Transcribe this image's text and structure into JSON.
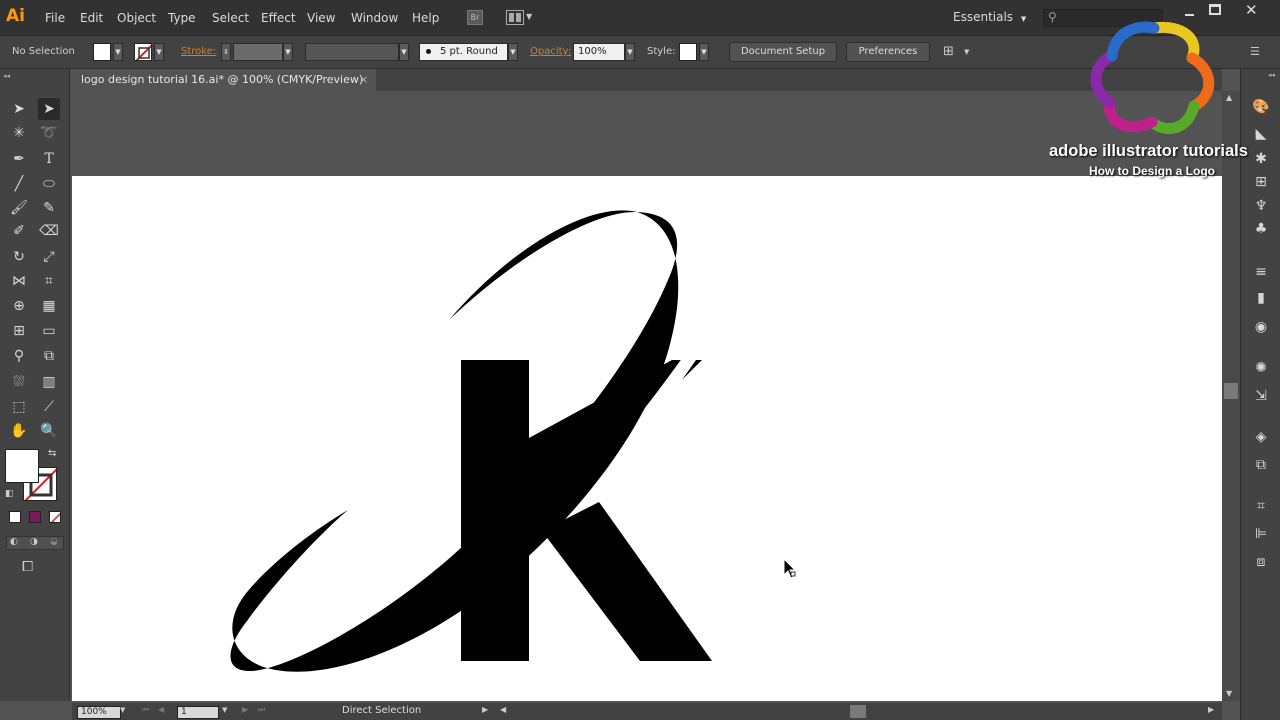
{
  "app": {
    "logo": "Ai"
  },
  "menu": [
    "File",
    "Edit",
    "Object",
    "Type",
    "Select",
    "Effect",
    "View",
    "Window",
    "Help"
  ],
  "menubar_right": {
    "bridge_label": "Br",
    "workspace": "Essentials",
    "search_placeholder": ""
  },
  "control_bar": {
    "selection_status": "No Selection",
    "stroke_label": "Stroke:",
    "brush": "5 pt. Round",
    "opacity_label": "Opacity:",
    "opacity_value": "100%",
    "style_label": "Style:",
    "document_setup": "Document Setup",
    "preferences": "Preferences"
  },
  "document_tab": {
    "title": "logo design tutorial 16.ai* @ 100% (CMYK/Preview)",
    "close": "×"
  },
  "status_bar": {
    "zoom": "100%",
    "artboard_number": "1",
    "current_tool": "Direct Selection"
  },
  "branding": {
    "title": "adobe illustrator tutorials",
    "subtitle": "How to Design a Logo"
  },
  "toolbar_tools": [
    "selection-tool",
    "direct-selection-tool",
    "magic-wand-tool",
    "lasso-tool",
    "pen-tool",
    "type-tool",
    "line-segment-tool",
    "ellipse-tool",
    "paintbrush-tool",
    "pencil-tool",
    "shaper-tool",
    "eraser-tool",
    "rotate-tool",
    "scale-tool",
    "width-tool",
    "free-transform-tool",
    "shape-builder-tool",
    "perspective-grid-tool",
    "mesh-tool",
    "gradient-tool",
    "eyedropper-tool",
    "blend-tool",
    "symbol-sprayer-tool",
    "column-graph-tool",
    "artboard-tool",
    "slice-tool",
    "hand-tool",
    "zoom-tool"
  ],
  "colors": {
    "fill": "#ffffff",
    "stroke": "none",
    "accent": "#ff9a00"
  }
}
